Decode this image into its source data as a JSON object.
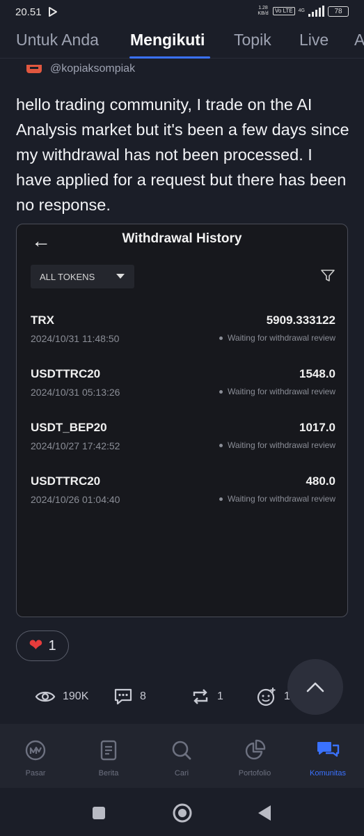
{
  "status_bar": {
    "time": "20.51",
    "network_speed": "1.28 KB/d",
    "volte": "Vo LTE",
    "net_type": "4G",
    "battery": "78"
  },
  "tabs": [
    {
      "label": "Untuk Anda",
      "active": false
    },
    {
      "label": "Mengikuti",
      "active": true
    },
    {
      "label": "Topik",
      "active": false
    },
    {
      "label": "Live",
      "active": false
    },
    {
      "label": "A",
      "active": false
    }
  ],
  "post": {
    "author": "@kopiaksompiak",
    "text": "hello trading community, I trade on the AI Analysis market but it's been a few days since my withdrawal has not been processed. I have applied for a request but there has been no response."
  },
  "embed": {
    "title": "Withdrawal History",
    "filter_select": "ALL TOKENS",
    "rows": [
      {
        "token": "TRX",
        "amount": "5909.333122",
        "date": "2024/10/31 11:48:50",
        "status": "Waiting for withdrawal review"
      },
      {
        "token": "USDTTRC20",
        "amount": "1548.0",
        "date": "2024/10/31 05:13:26",
        "status": "Waiting for withdrawal review"
      },
      {
        "token": "USDT_BEP20",
        "amount": "1017.0",
        "date": "2024/10/27 17:42:52",
        "status": "Waiting for withdrawal review"
      },
      {
        "token": "USDTTRC20",
        "amount": "480.0",
        "date": "2024/10/26 01:04:40",
        "status": "Waiting for withdrawal review"
      }
    ]
  },
  "reaction": {
    "count": "1"
  },
  "stats": {
    "views": "190K",
    "comments": "8",
    "reposts": "1",
    "reactions": "1"
  },
  "bottom_nav": [
    {
      "label": "Pasar",
      "icon": "market-icon",
      "active": false
    },
    {
      "label": "Berita",
      "icon": "news-icon",
      "active": false
    },
    {
      "label": "Cari",
      "icon": "search-icon",
      "active": false
    },
    {
      "label": "Portofolio",
      "icon": "portfolio-icon",
      "active": false
    },
    {
      "label": "Komunitas",
      "icon": "community-icon",
      "active": true
    }
  ],
  "colors": {
    "accent": "#3a72ff",
    "background": "#1b1e28",
    "heart": "#e63c3c"
  }
}
